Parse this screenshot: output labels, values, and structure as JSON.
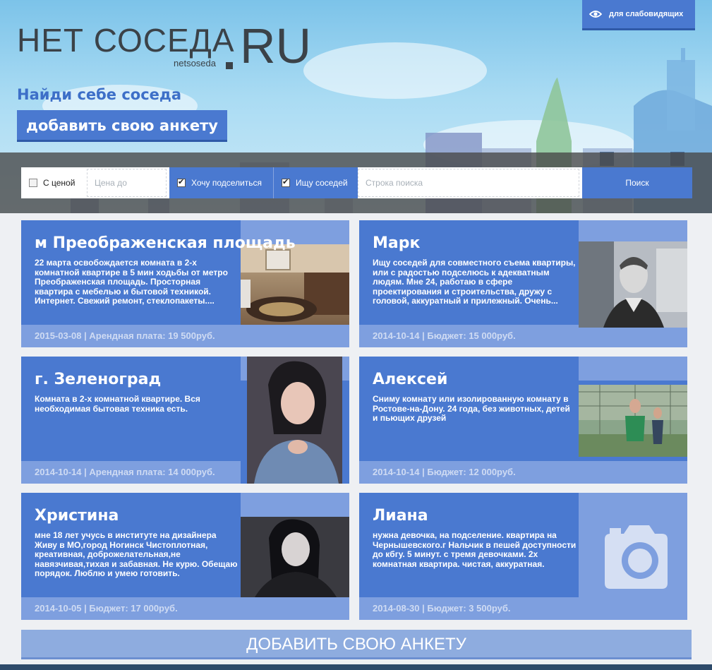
{
  "header": {
    "logo_main": "НЕТ СОСЕДА",
    "logo_ru": "RU",
    "logo_sub": "netsoseda",
    "tagline": "Найди себе соседа",
    "add_button": "добавить свою анкету",
    "accessibility_button": "для слабовидящих"
  },
  "filters": {
    "with_price_label": "С ценой",
    "price_placeholder": "Цена до",
    "want_share_label": "Хочу подселиться",
    "seek_neighbors_label": "Ищу соседей",
    "search_placeholder": "Строка поиска",
    "search_button": "Поиск",
    "with_price_checked": false,
    "want_share_checked": true,
    "seek_neighbors_checked": true
  },
  "cards": [
    {
      "title": "м Преображенская площадь",
      "description": "22 марта освобождается комната в 2-х комнатной квартире в 5 мин ходьбы от метро Преображенская площадь. Просторная квартира с мебелью и бытовой техникой. Интернет. Свежий ремонт, стеклопакеты....",
      "footer": "2015-03-08 | Арендная плата: 19 500руб.",
      "photo": "room-photo"
    },
    {
      "title": "Марк",
      "description": "Ищу соседей для совместного съема квартиры, или с радостью подселюсь к адекватным людям. Мне 24, работаю в сфере проектирования и строительства, дружу с головой, аккуратный и прилежный. Очень...",
      "footer": "2014-10-14 | Бюджет: 15 000руб.",
      "photo": "man-photo"
    },
    {
      "title": "г. Зеленоград",
      "description": "Комната в 2-х комнатной квартире. Вся необходимая бытовая техника есть.",
      "footer": "2014-10-14 | Арендная плата: 14 000руб.",
      "photo": "woman-photo"
    },
    {
      "title": "Алексей",
      "description": "Сниму комнату или изолированную комнату в Ростове-на-Дону. 24 года, без животных, детей и пьющих друзей",
      "footer": "2014-10-14 | Бюджет: 12 000руб.",
      "photo": "football-photo"
    },
    {
      "title": "Христина",
      "description": "мне 18 лет учусь в институте на дизайнера Живу в МО,город Ногинск Чистоплотная, креативная, доброжелательная,не навязчивая,тихая и забавная. Не курю. Обещаю порядок. Люблю и умею готовить.",
      "footer": "2014-10-05 | Бюджет: 17 000руб.",
      "photo": "girl-photo"
    },
    {
      "title": "Лиана",
      "description": "нужна девочка, на подселение. квартира на Чернышевского.г Нальчик в пешей доступности до кбгу. 5 минут. с тремя девочками. 2х комнатная квартира. чистая, аккуратная.",
      "footer": "2014-08-30 | Бюджет: 3 500руб.",
      "photo": "camera-placeholder-icon"
    }
  ],
  "bottom_button": "ДОБАВИТЬ СВОЮ АНКЕТУ",
  "colors": {
    "accent": "#4a79d0",
    "accent_light": "#7e9fdf",
    "text_dark": "#3b4248"
  }
}
